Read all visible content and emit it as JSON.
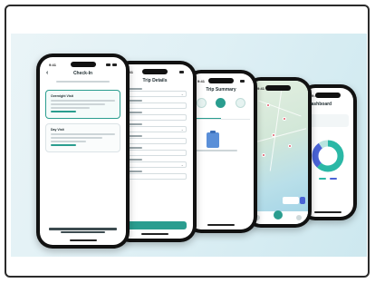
{
  "phones": [
    {
      "id": "plan-choice",
      "title": "Check-In",
      "has_back": true,
      "status_time": "9:41",
      "cards": [
        {
          "title": "Overnight Visit",
          "selected": true
        },
        {
          "title": "Day Visit",
          "selected": false
        }
      ]
    },
    {
      "id": "trip-form",
      "title": "Trip Details",
      "has_back": true,
      "status_time": "9:41",
      "field_count": 8,
      "primary_button_label": ""
    },
    {
      "id": "checklist",
      "title": "Trip Summary",
      "has_back": true,
      "status_time": "9:41",
      "icons": [
        "tent-icon",
        "car-icon",
        "person-icon"
      ],
      "tabs": [
        "",
        ""
      ]
    },
    {
      "id": "map",
      "status_time": "9:41"
    },
    {
      "id": "stats",
      "status_time": "9:41",
      "title": "Dashboard",
      "donut": [
        {
          "name": "",
          "fraction": 0.62,
          "color": "#2bb8a6"
        },
        {
          "name": "",
          "fraction": 0.28,
          "color": "#4a63d6"
        },
        {
          "name": "",
          "fraction": 0.1,
          "color": "#b9e4df"
        }
      ]
    }
  ],
  "colors": {
    "accent": "#2a9d8f",
    "secondary": "#4a63d6",
    "background_gradient": "#cde8ef"
  }
}
